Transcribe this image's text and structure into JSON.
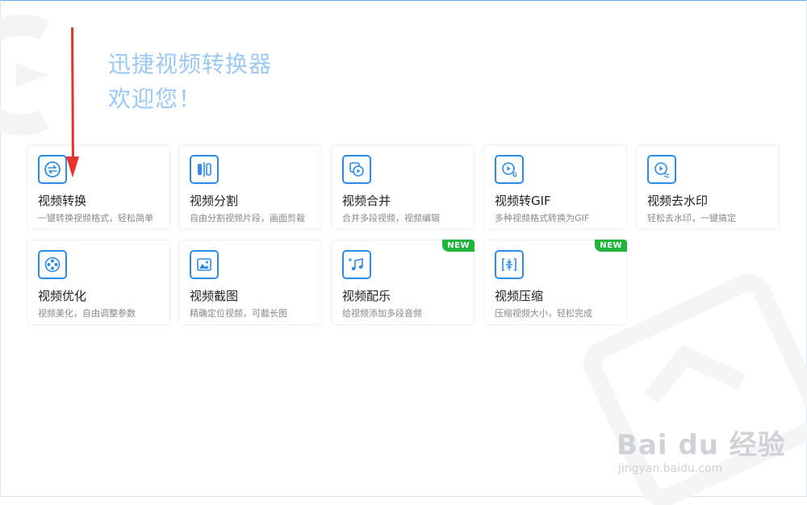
{
  "app": {
    "welcome_line1": "迅捷视频转换器",
    "welcome_line2": "欢迎您！"
  },
  "features": [
    {
      "title": "视频转换",
      "desc": "一键转换视频格式，轻松简单",
      "icon": "convert-icon",
      "badge": ""
    },
    {
      "title": "视频分割",
      "desc": "自由分割视频片段，画面剪裁",
      "icon": "split-icon",
      "badge": ""
    },
    {
      "title": "视频合并",
      "desc": "合并多段视频，视频编辑",
      "icon": "merge-icon",
      "badge": ""
    },
    {
      "title": "视频转GIF",
      "desc": "多种视频格式转换为GIF",
      "icon": "gif-icon",
      "badge": ""
    },
    {
      "title": "视频去水印",
      "desc": "轻松去水印，一键搞定",
      "icon": "watermark-remove-icon",
      "badge": ""
    },
    {
      "title": "视频优化",
      "desc": "视频美化，自由调整参数",
      "icon": "optimize-icon",
      "badge": ""
    },
    {
      "title": "视频截图",
      "desc": "精确定位视频，可截长图",
      "icon": "screenshot-icon",
      "badge": ""
    },
    {
      "title": "视频配乐",
      "desc": "给视频添加多段音频",
      "icon": "music-icon",
      "badge": "NEW"
    },
    {
      "title": "视频压缩",
      "desc": "压缩视频大小，轻松完成",
      "icon": "compress-icon",
      "badge": "NEW"
    }
  ],
  "watermark": {
    "logo": "Bai du 经验",
    "url": "jingyan.baidu.com"
  },
  "colors": {
    "accent": "#2f8ce6",
    "welcome": "#9cc8f3",
    "badge": "#21b33c",
    "annotation_arrow": "#e8322d"
  }
}
